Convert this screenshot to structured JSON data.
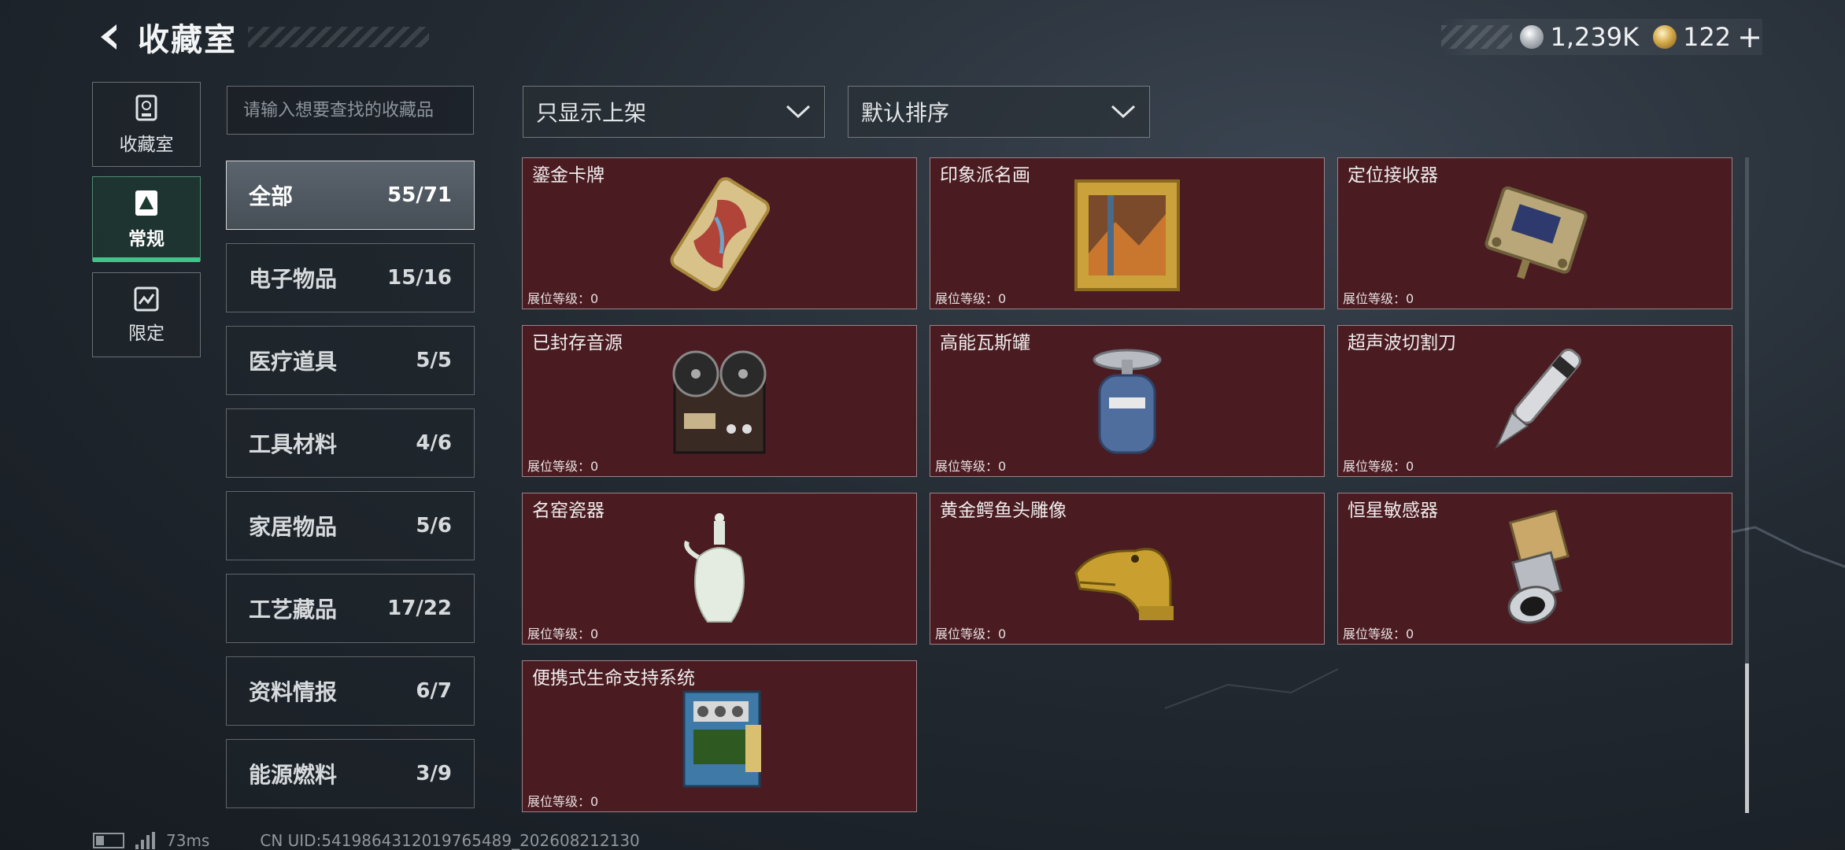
{
  "header": {
    "title": "收藏室"
  },
  "currency": {
    "silver": "1,239K",
    "gold": "122",
    "add": "+"
  },
  "nav": [
    {
      "label": "收藏室",
      "icon": "trophy-icon",
      "active": false
    },
    {
      "label": "常规",
      "icon": "warning-icon",
      "active": true
    },
    {
      "label": "限定",
      "icon": "limited-icon",
      "active": false
    }
  ],
  "search": {
    "placeholder": "请输入想要查找的收藏品"
  },
  "categories": [
    {
      "label": "全部",
      "count": "55/71",
      "active": true
    },
    {
      "label": "电子物品",
      "count": "15/16"
    },
    {
      "label": "医疗道具",
      "count": "5/5"
    },
    {
      "label": "工具材料",
      "count": "4/6"
    },
    {
      "label": "家居物品",
      "count": "5/6"
    },
    {
      "label": "工艺藏品",
      "count": "17/22"
    },
    {
      "label": "资料情报",
      "count": "6/7"
    },
    {
      "label": "能源燃料",
      "count": "3/9"
    }
  ],
  "filters": {
    "shelf": "只显示上架",
    "sort": "默认排序"
  },
  "items": [
    {
      "name": "鎏金卡牌",
      "level": "展位等级：0",
      "icon": "gilded-card-icon"
    },
    {
      "name": "印象派名画",
      "level": "展位等级：0",
      "icon": "framed-painting-icon"
    },
    {
      "name": "定位接收器",
      "level": "展位等级：0",
      "icon": "gps-receiver-icon"
    },
    {
      "name": "已封存音源",
      "level": "展位等级：0",
      "icon": "reel-recorder-icon"
    },
    {
      "name": "高能瓦斯罐",
      "level": "展位等级：0",
      "icon": "gas-canister-icon"
    },
    {
      "name": "超声波切割刀",
      "level": "展位等级：0",
      "icon": "ultrasonic-cutter-icon"
    },
    {
      "name": "名窑瓷器",
      "level": "展位等级：0",
      "icon": "porcelain-vase-icon"
    },
    {
      "name": "黄金鳄鱼头雕像",
      "level": "展位等级：0",
      "icon": "golden-crocodile-icon"
    },
    {
      "name": "恒星敏感器",
      "level": "展位等级：0",
      "icon": "star-sensor-icon"
    },
    {
      "name": "便携式生命支持系统",
      "level": "展位等级：0",
      "icon": "life-support-icon"
    }
  ],
  "footer": {
    "ping": "73ms",
    "uid": "CN UID:5419864312019765489_202608212130"
  },
  "colors": {
    "card_bg": "#4a1c22",
    "accent": "#3fc58a"
  }
}
